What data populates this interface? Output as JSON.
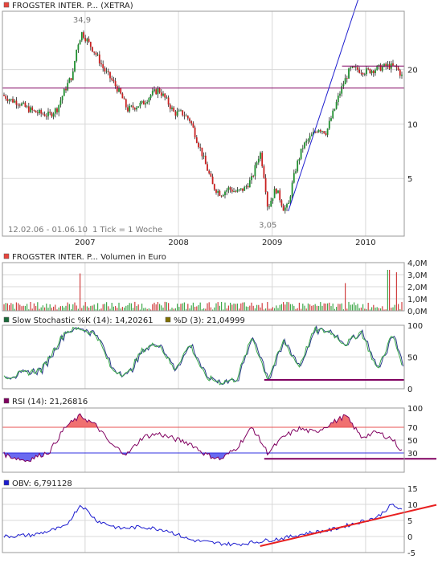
{
  "chart_data": [
    {
      "type": "candlestick",
      "title": "FROGSTER INTER. P... (XETRA)",
      "color_swatch": "#e8453c",
      "range_label": "12.02.06 - 01.06.10",
      "tick_label": "1 Tick = 1 Woche",
      "scale": "log",
      "y_ticks": [
        5,
        10,
        20
      ],
      "y_tick_labels": [
        "5",
        "10",
        "20"
      ],
      "ylim": [
        2.4,
        42
      ],
      "x_ticks": [
        "2007",
        "2008",
        "2009",
        "2010"
      ],
      "x_tick_years": [
        2007,
        2008,
        2009,
        2010
      ],
      "xlim": [
        "2006-02-12",
        "2010-06-01"
      ],
      "annotations": [
        {
          "text": "34,9",
          "x": "2006-12-20",
          "y": 34.9
        },
        {
          "text": "3,05",
          "x": "2008-12-15",
          "y": 3.05
        }
      ],
      "horizontal_lines": [
        {
          "y": 15.8,
          "color": "#800060"
        },
        {
          "y": 20.9,
          "color": "#800060",
          "x_from": "2009-10-01",
          "x_to": "2010-06-01"
        }
      ],
      "trendline": {
        "color": "#1f1fcf",
        "x1": "2009-03-05",
        "y1": 3.3,
        "x2": "2009-12-15",
        "y2": 55
      },
      "series": [
        {
          "x": [
            "2006-02-12",
            "2006-03-15",
            "2006-04-15",
            "2006-05-15",
            "2006-06-15",
            "2006-07-15",
            "2006-08-15",
            "2006-09-15",
            "2006-10-15",
            "2006-11-15",
            "2006-12-01",
            "2006-12-20",
            "2007-01-15",
            "2007-02-15",
            "2007-03-15",
            "2007-04-15",
            "2007-05-15",
            "2007-06-15",
            "2007-07-15",
            "2007-08-15",
            "2007-09-15",
            "2007-10-15",
            "2007-11-15",
            "2007-12-15",
            "2008-01-15",
            "2008-02-15",
            "2008-03-15",
            "2008-04-15",
            "2008-05-15",
            "2008-06-15",
            "2008-07-15",
            "2008-08-15",
            "2008-09-15",
            "2008-10-15",
            "2008-11-15",
            "2008-12-15",
            "2009-01-15",
            "2009-02-15",
            "2009-03-05",
            "2009-04-01",
            "2009-05-01",
            "2009-06-01",
            "2009-07-01",
            "2009-08-01",
            "2009-09-01",
            "2009-10-01",
            "2009-11-01",
            "2009-12-01",
            "2010-01-01",
            "2010-02-01",
            "2010-03-01",
            "2010-04-01",
            "2010-05-01",
            "2010-06-01"
          ],
          "y": [
            14.5,
            13.6,
            13.2,
            12.3,
            11.7,
            11.4,
            11.2,
            12.2,
            15.5,
            19,
            27,
            32,
            28,
            24,
            20,
            17.5,
            15,
            12,
            12.5,
            13,
            14.5,
            15.5,
            13.5,
            11.5,
            11.5,
            10.5,
            8,
            6,
            4.5,
            4.1,
            4.4,
            4.2,
            4.4,
            5,
            7,
            3.4,
            4.4,
            3.4,
            3.5,
            5.5,
            7.5,
            8.5,
            9.5,
            9,
            12,
            16,
            20,
            20,
            19.5,
            20,
            20.5,
            21,
            20.5,
            17.5
          ]
        }
      ]
    },
    {
      "type": "bar",
      "title": "FROGSTER INTER. P... Volumen in Euro",
      "color_swatch": "#e8453c",
      "y_ticks": [
        0,
        1,
        2,
        3,
        4
      ],
      "y_tick_labels": [
        "0,0M",
        "1,0M",
        "2,0M",
        "3,0M",
        "4,0M"
      ],
      "ylim": [
        0,
        4
      ],
      "notable_values": [
        {
          "x": "2006-12-15",
          "y": 3.1
        },
        {
          "x": "2009-10-15",
          "y": 2.3
        },
        {
          "x": "2010-04-01",
          "y": 3.4
        },
        {
          "x": "2010-05-01",
          "y": 3.2
        }
      ],
      "typical_value": 0.5
    },
    {
      "type": "line",
      "title": "Slow Stochastic %K (14): 14,20261",
      "title2": "%D (3): 21,04999",
      "color_swatch": "#1b6b3a",
      "color_swatch2": "#807000",
      "y_ticks": [
        0,
        50,
        100
      ],
      "y_tick_labels": [
        "0",
        "50",
        "100"
      ],
      "ylim": [
        0,
        100
      ],
      "horizontal_lines": [
        {
          "y": 14,
          "color": "#800060",
          "x_from": "2008-12-01",
          "x_to": "2010-06-01"
        }
      ],
      "series": [
        {
          "name": "%K",
          "color": "#3aa84a"
        },
        {
          "name": "%D",
          "color": "#2a3a8a"
        }
      ],
      "x": [
        "2006-03",
        "2006-07",
        "2006-10",
        "2006-12",
        "2007-02",
        "2007-04",
        "2007-06",
        "2007-08",
        "2007-10",
        "2007-12",
        "2008-02",
        "2008-04",
        "2008-06",
        "2008-08",
        "2008-10",
        "2008-12",
        "2009-02",
        "2009-04",
        "2009-06",
        "2009-08",
        "2009-10",
        "2009-12",
        "2010-02",
        "2010-04",
        "2010-06"
      ],
      "y": [
        20,
        30,
        90,
        95,
        85,
        30,
        22,
        62,
        72,
        30,
        70,
        18,
        10,
        15,
        82,
        15,
        75,
        35,
        92,
        90,
        70,
        90,
        30,
        85,
        15
      ]
    },
    {
      "type": "line",
      "title": "RSI (14): 21,26816",
      "color_swatch": "#800060",
      "y_ticks": [
        30,
        50,
        70,
        100
      ],
      "y_tick_labels": [
        "30",
        "50",
        "70",
        "100"
      ],
      "ylim": [
        0,
        100
      ],
      "reference_lines": [
        {
          "y": 70,
          "color": "#e85050"
        },
        {
          "y": 30,
          "color": "#3030e0"
        }
      ],
      "horizontal_lines": [
        {
          "y": 21,
          "color": "#800060",
          "x_from": "2008-12-01",
          "x_to": "2010-06-01"
        }
      ],
      "x": [
        "2006-02",
        "2006-05",
        "2006-08",
        "2006-10",
        "2006-12",
        "2007-02",
        "2007-04",
        "2007-06",
        "2007-08",
        "2007-10",
        "2007-12",
        "2008-02",
        "2008-04",
        "2008-06",
        "2008-08",
        "2008-10",
        "2008-12",
        "2009-02",
        "2009-04",
        "2009-06",
        "2009-08",
        "2009-10",
        "2009-12",
        "2010-02",
        "2010-04",
        "2010-06"
      ],
      "y": [
        28,
        18,
        32,
        70,
        88,
        72,
        42,
        28,
        55,
        60,
        52,
        45,
        28,
        20,
        38,
        70,
        30,
        55,
        68,
        62,
        75,
        88,
        55,
        62,
        52,
        21
      ]
    },
    {
      "type": "line",
      "title": "OBV: 6,791128",
      "color_swatch": "#1b1bcf",
      "y_ticks": [
        -5,
        0,
        5,
        10,
        15
      ],
      "y_tick_labels": [
        "-5",
        "0",
        "5",
        "10",
        "15"
      ],
      "ylim": [
        -5,
        15
      ],
      "trendline": {
        "color": "#e82020",
        "x1": "2008-11-15",
        "y1": -3,
        "x2": "2010-06-01",
        "y2": 7.5
      },
      "x": [
        "2006-02",
        "2006-06",
        "2006-10",
        "2006-12",
        "2007-02",
        "2007-05",
        "2007-08",
        "2007-11",
        "2008-02",
        "2008-05",
        "2008-08",
        "2008-11",
        "2009-02",
        "2009-05",
        "2009-08",
        "2009-11",
        "2010-02",
        "2010-04",
        "2010-06"
      ],
      "y": [
        0,
        0.5,
        3,
        10,
        5,
        2.5,
        3,
        2,
        -1,
        -2,
        -2.5,
        -1.5,
        -0.5,
        1,
        2,
        4,
        6,
        10,
        6.8
      ]
    }
  ]
}
